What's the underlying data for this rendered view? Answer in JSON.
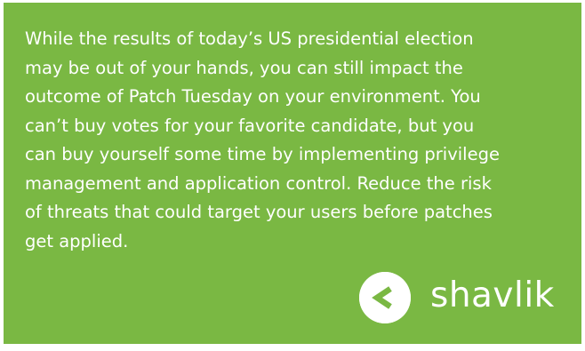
{
  "ad": {
    "body_text": "While the results of today’s US presidential election\nmay be out of your hands, you can still impact the\noutcome of Patch Tuesday on your environment.  You\ncan’t buy votes for your favorite candidate, but you\ncan buy yourself some time by implementing privilege\nmanagement and application control. Reduce the risk\nof threats that could target your users before patches\nget applied.",
    "brand_name": "shavlik",
    "brand_icon": "shavlik-chevron-logo-icon",
    "background_color": "#7ab843",
    "text_color": "#ffffff"
  }
}
